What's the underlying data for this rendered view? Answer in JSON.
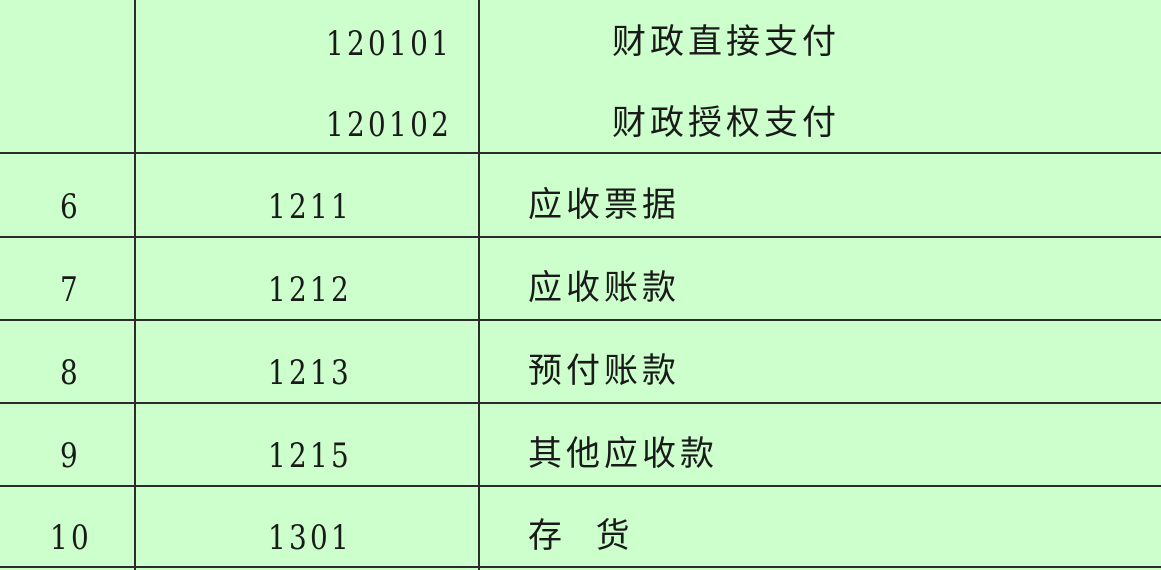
{
  "table": {
    "top_rows": [
      {
        "code": "120101",
        "name": "财政直接支付"
      },
      {
        "code": "120102",
        "name": "财政授权支付"
      }
    ],
    "rows": [
      {
        "index": "6",
        "code": "1211",
        "name": "应收票据"
      },
      {
        "index": "7",
        "code": "1212",
        "name": "应收账款"
      },
      {
        "index": "8",
        "code": "1213",
        "name": "预付账款"
      },
      {
        "index": "9",
        "code": "1215",
        "name": "其他应收款"
      },
      {
        "index": "10",
        "code": "1301",
        "name": "存  货"
      }
    ]
  }
}
